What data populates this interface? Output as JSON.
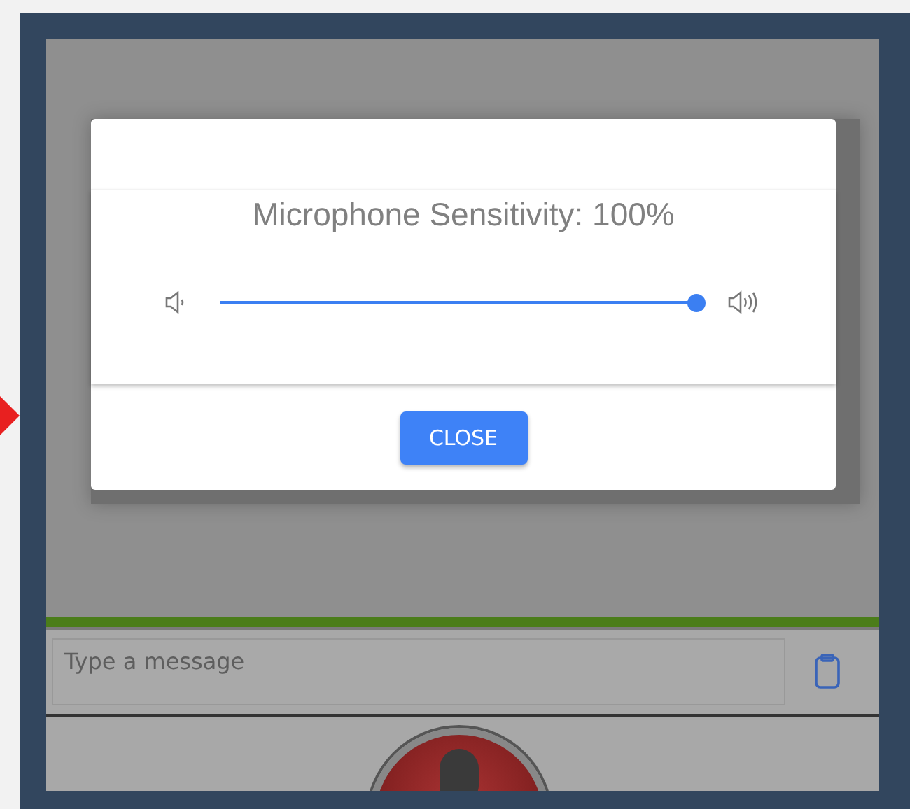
{
  "dialog": {
    "title": "Microphone Sensitivity: 100%",
    "slider": {
      "level": 1
    },
    "button": "CLOSE"
  },
  "composer": {
    "placeholder": "Type a message"
  }
}
